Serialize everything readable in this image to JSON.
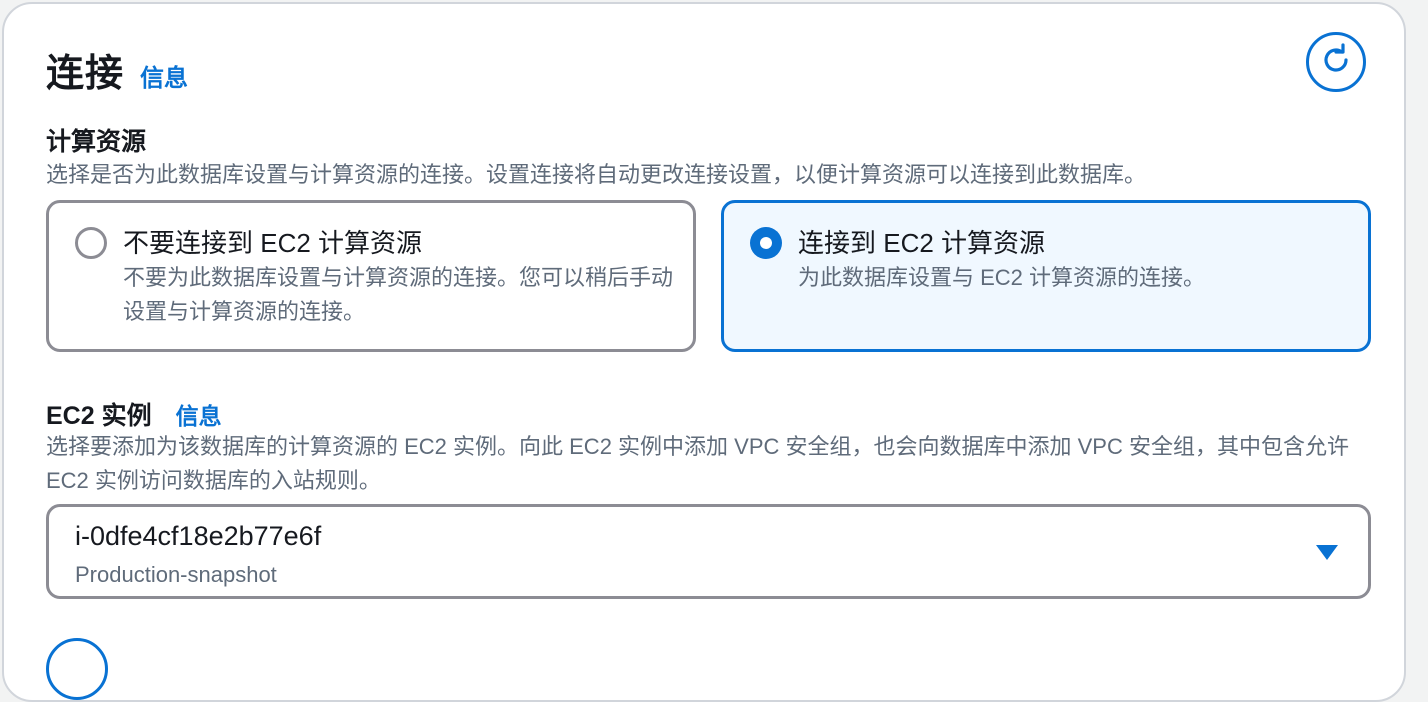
{
  "panel": {
    "title": "连接",
    "info_label": "信息"
  },
  "compute": {
    "label": "计算资源",
    "description": "选择是否为此数据库设置与计算资源的连接。设置连接将自动更改连接设置，以便计算资源可以连接到此数据库。",
    "options": [
      {
        "title": "不要连接到 EC2 计算资源",
        "description": "不要为此数据库设置与计算资源的连接。您可以稍后手动设置与计算资源的连接。",
        "selected": false
      },
      {
        "title": "连接到 EC2 计算资源",
        "description": "为此数据库设置与 EC2 计算资源的连接。",
        "selected": true
      }
    ]
  },
  "ec2": {
    "label": "EC2 实例",
    "info_label": "信息",
    "description": "选择要添加为该数据库的计算资源的 EC2 实例。向此 EC2 实例中添加 VPC 安全组，也会向数据库中添加 VPC 安全组，其中包含允许 EC2 实例访问数据库的入站规则。",
    "selected_instance_id": "i-0dfe4cf18e2b77e6f",
    "selected_instance_name": "Production-snapshot"
  },
  "colors": {
    "accent": "#0972d3",
    "selected_tile_bg": "#f0f8ff",
    "muted_text": "#5f6b7a"
  },
  "icons": {
    "refresh": "refresh-icon",
    "dropdown": "caret-down-icon"
  }
}
